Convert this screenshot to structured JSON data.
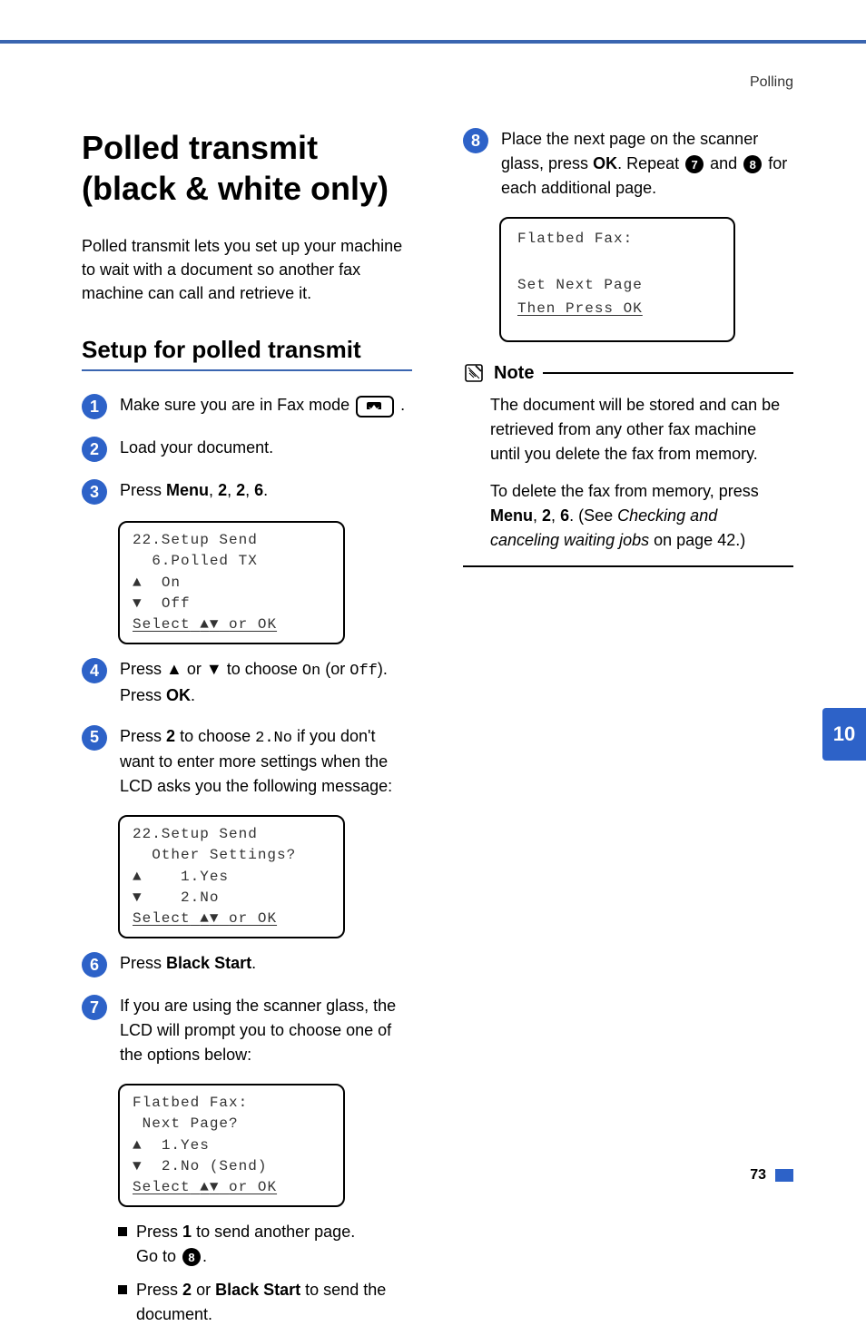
{
  "header": {
    "section": "Polling"
  },
  "title": "Polled transmit (black & white only)",
  "intro": "Polled transmit lets you set up your machine to wait with a document so another fax machine can call and retrieve it.",
  "subheading": "Setup for polled transmit",
  "steps": [
    {
      "num": "1",
      "pre": "Make sure you are in Fax mode",
      "post": "."
    },
    {
      "num": "2",
      "text": "Load your document."
    },
    {
      "num": "3",
      "p1": "Press",
      "b1": "Menu",
      "p2": ",",
      "b2": "2",
      "p3": ",",
      "b3": "2",
      "p4": ",",
      "b4": "6",
      "p5": "."
    },
    {
      "num": "4",
      "p1": "Press",
      "p2": "or",
      "p3": "to choose",
      "m1": "On",
      "p4": "(or",
      "m2": "Off",
      "p5": ").",
      "p6": "Press",
      "b1": "OK",
      "p7": "."
    },
    {
      "num": "5",
      "p1": "Press",
      "b1": "2",
      "p2": "to choose",
      "m1": "2.No",
      "p3": "if you don't want to enter more settings when the LCD asks you the following message:"
    },
    {
      "num": "6",
      "p1": "Press",
      "b1": "Black Start",
      "p2": "."
    },
    {
      "num": "7",
      "text": "If you are using the scanner glass, the LCD will prompt you to choose one of the options below:"
    },
    {
      "num": "8",
      "p1": "Place the next page on the scanner glass, press",
      "b1": "OK",
      "p2": ". Repeat",
      "ref1": "7",
      "p3": "and",
      "ref2": "8",
      "p4": "for each additional page."
    }
  ],
  "lcd1": {
    "l1": "22.Setup Send",
    "l2": "  6.Polled TX",
    "l3": "On",
    "l4": "Off",
    "l5a": "Select",
    "l5b": "or OK"
  },
  "lcd2": {
    "l1": "22.Setup Send",
    "l2": "  Other Settings?",
    "l3": "1.Yes",
    "l4": "2.No",
    "l5a": "Select",
    "l5b": "or OK"
  },
  "lcd3": {
    "l1": "Flatbed Fax:",
    "l2": " Next Page?",
    "l3": "1.Yes",
    "l4": "2.No (Send)",
    "l5a": "Select",
    "l5b": "or OK"
  },
  "lcd4": {
    "l1": "Flatbed Fax:",
    "l2": "Set Next Page",
    "l3": "Then Press OK"
  },
  "bullets7": [
    {
      "p1": "Press",
      "b1": "1",
      "p2": "to send another page.",
      "p3": "Go to",
      "ref": "8",
      "p4": "."
    },
    {
      "p1": "Press",
      "b1": "2",
      "p2": "or",
      "b2": "Black Start",
      "p3": "to send the document."
    }
  ],
  "note": {
    "title": "Note",
    "p1": "The document will be stored and can be retrieved from any other fax machine until you delete the fax from memory.",
    "p2a": "To delete the fax from memory, press",
    "b1": "Menu",
    "p2b": ",",
    "b2": "2",
    "p2c": ",",
    "b3": "6",
    "p2d": ". (See",
    "i1": "Checking and canceling waiting jobs",
    "p2e": "on page 42.)"
  },
  "sidetab": "10",
  "footer": {
    "page": "73"
  }
}
